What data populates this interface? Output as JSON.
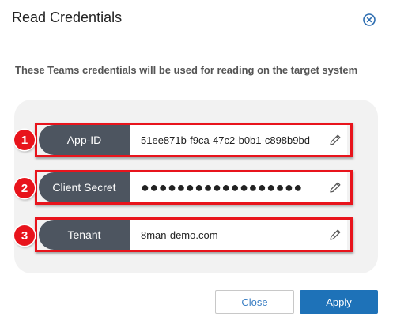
{
  "dialog": {
    "title": "Read Credentials",
    "description": "These Teams credentials will be used for reading on the target system"
  },
  "fields": [
    {
      "marker": "1",
      "label": "App-ID",
      "value": "51ee871b-f9ca-47c2-b0b1-c898b9bd"
    },
    {
      "marker": "2",
      "label": "Client Secret",
      "value": "●●●●●●●●●●●●●●●●●●"
    },
    {
      "marker": "3",
      "label": "Tenant",
      "value": "8man-demo.com"
    }
  ],
  "buttons": {
    "close_label": "Close",
    "apply_label": "Apply"
  },
  "colors": {
    "accent": "#1e72b8",
    "annotation_red": "#e8141c",
    "label_pill": "#4d5560"
  },
  "icons": {
    "close": "close-circle-icon",
    "edit": "pencil-icon"
  }
}
